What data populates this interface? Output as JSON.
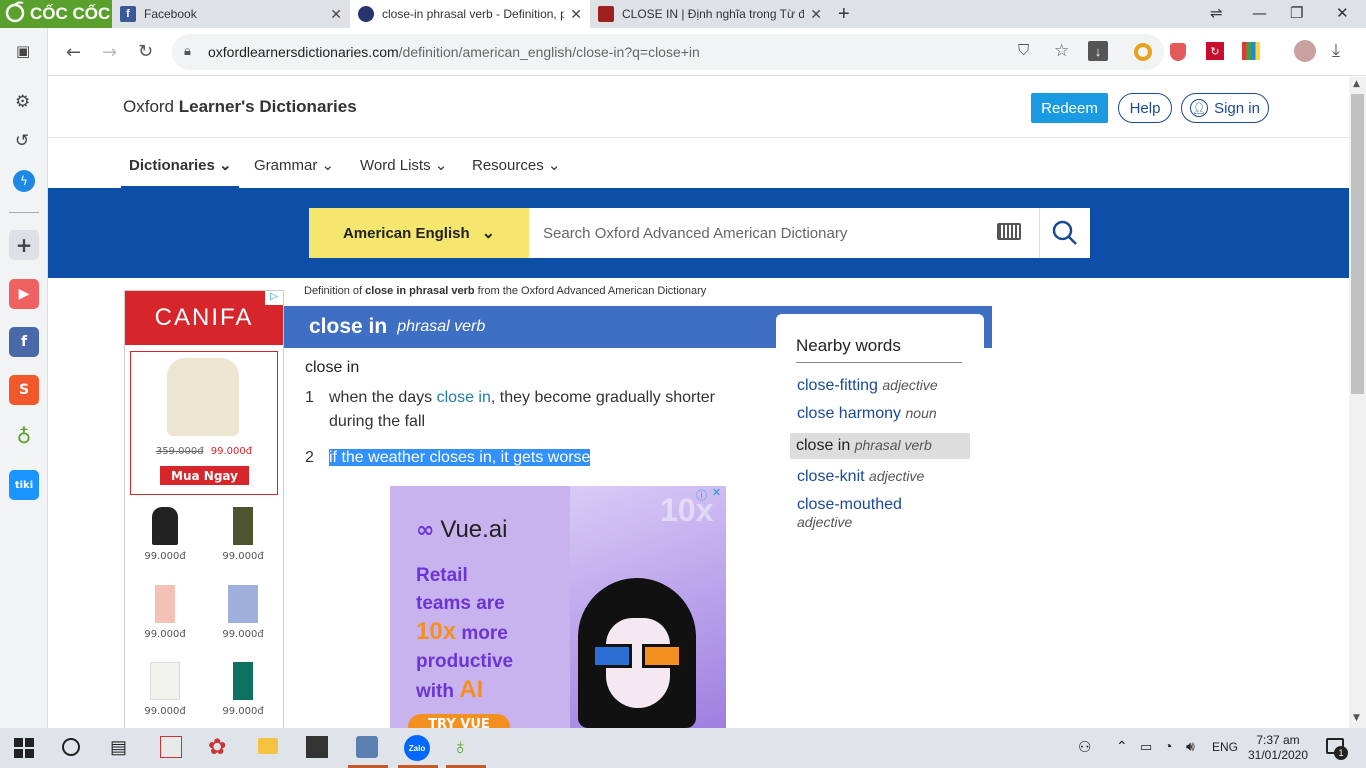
{
  "browser": {
    "brand": "CỐC CỐC",
    "tabs": [
      {
        "title": "Facebook",
        "close": "✕"
      },
      {
        "title": "close-in phrasal verb - Definition, p",
        "close": "✕"
      },
      {
        "title": "CLOSE IN | Định nghĩa trong Từ điể",
        "close": "✕"
      }
    ],
    "new_tab": "+",
    "url_host": "oxfordlearnersdictionaries.com",
    "url_path": "/definition/american_english/close-in?q=close+in"
  },
  "site": {
    "title_plain": "Oxford ",
    "title_bold": "Learner's Dictionaries",
    "redeem": "Redeem",
    "help": "Help",
    "signin": "Sign in",
    "nav": [
      {
        "label": "Dictionaries"
      },
      {
        "label": "Grammar"
      },
      {
        "label": "Word Lists"
      },
      {
        "label": "Resources"
      }
    ],
    "dictionary": "American English",
    "search_placeholder": "Search Oxford Advanced American Dictionary"
  },
  "ad_left": {
    "brand": "CANIFA",
    "old_price": "359.000đ",
    "new_price": "99.000đ",
    "cta": "Mua Ngay",
    "items": [
      "99.000đ",
      "99.000đ",
      "99.000đ",
      "99.000đ",
      "99.000đ",
      "99.000đ"
    ]
  },
  "entry": {
    "definition_prefix": "Definition of ",
    "definition_word": "close in phrasal verb",
    "definition_suffix": " from the Oxford Advanced American Dictionary",
    "headword": "close in",
    "pos": "phrasal verb",
    "phrase": "close in",
    "senses": [
      {
        "num": "1",
        "pre": "when the days ",
        "link": "close in",
        "post": ", they become gradually shorter during the fall"
      },
      {
        "num": "2",
        "text": "if the weather closes in, it gets worse"
      }
    ]
  },
  "nearby": {
    "title": "Nearby words",
    "items": [
      {
        "word": "close-fitting",
        "pos": "adjective"
      },
      {
        "word": "close harmony",
        "pos": "noun"
      },
      {
        "word": "close in",
        "pos": "phrasal verb"
      },
      {
        "word": "close-knit",
        "pos": "adjective"
      },
      {
        "word": "close-mouthed",
        "pos": "adjective"
      }
    ]
  },
  "ad_mid": {
    "brand": "Vue.ai",
    "line1": "Retail",
    "line2": "teams are",
    "line3a": "10x",
    "line3b": " more",
    "line4": "productive",
    "line5a": "with ",
    "line5b": "AI",
    "watermark": "10x",
    "cta": "TRY VUE"
  },
  "taskbar": {
    "lang": "ENG",
    "time": "7:37 am",
    "date": "31/01/2020",
    "notif_count": "1"
  },
  "colors": {
    "brand_green": "#5aa02c",
    "oxford_blue": "#0d4ea6",
    "header_blue": "#3f6fc2",
    "dict_yellow": "#f5e76d",
    "redeem_blue": "#1a9ae0",
    "canifa_red": "#d6252b"
  }
}
